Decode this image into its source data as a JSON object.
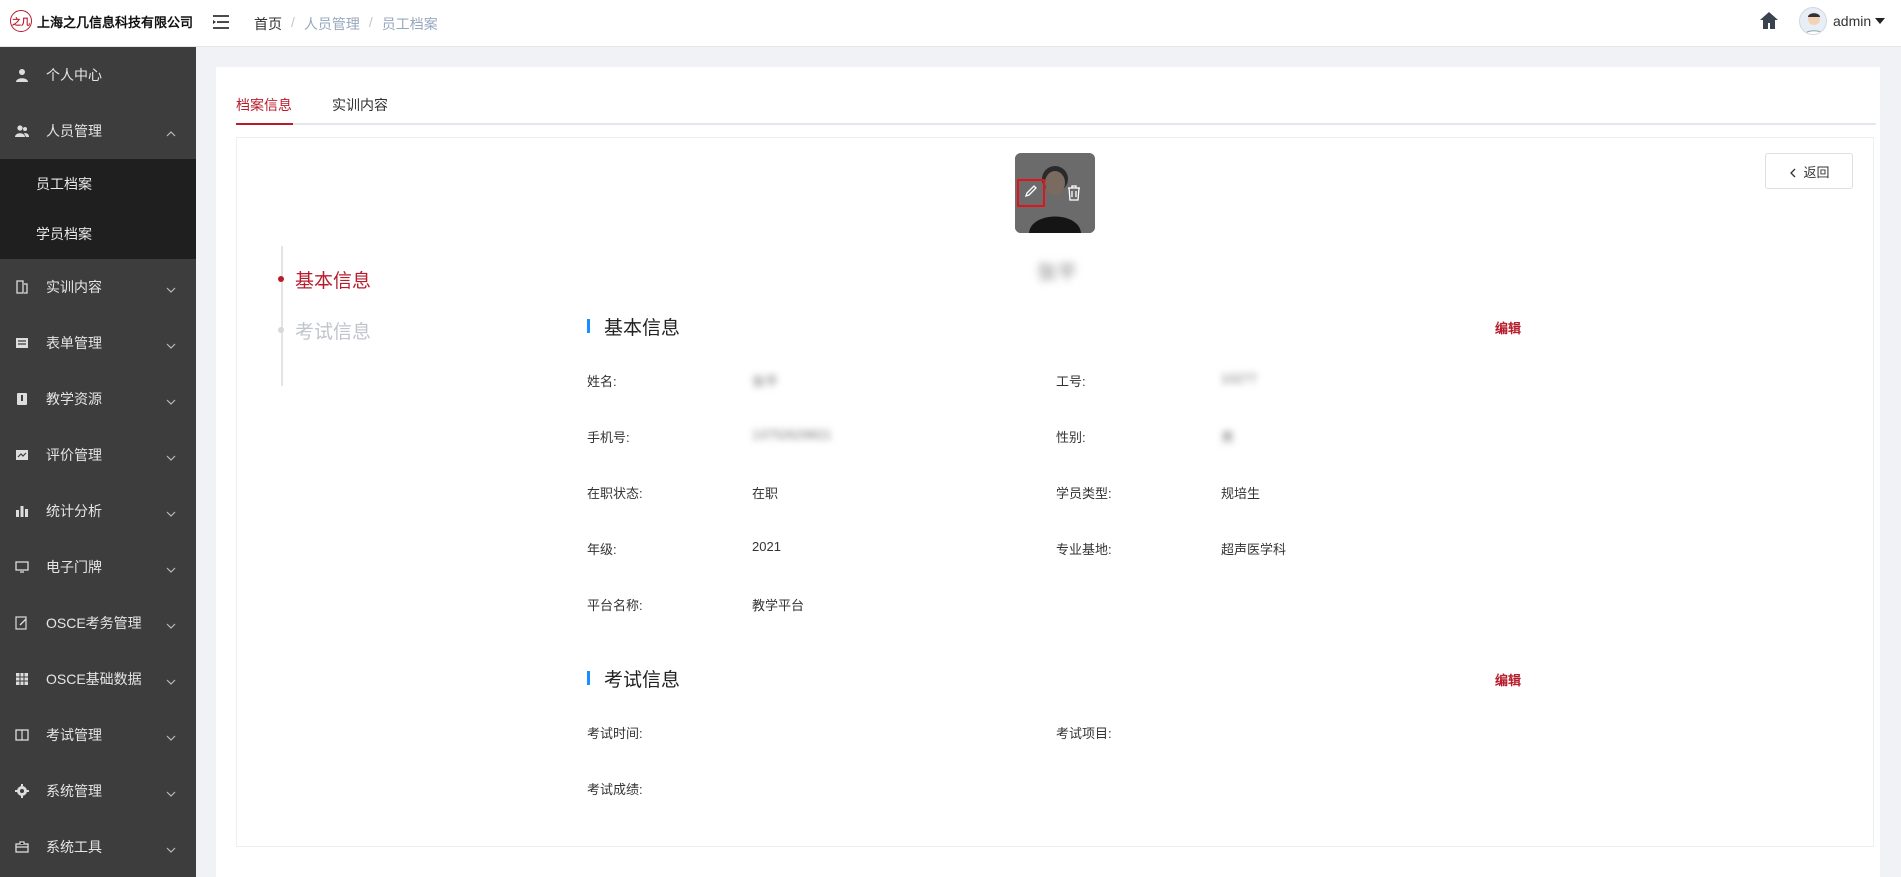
{
  "header": {
    "company_name": "上海之几信息科技有限公司",
    "logo_mark": "之几",
    "breadcrumb": [
      "首页",
      "人员管理",
      "员工档案"
    ],
    "breadcrumb_sep": "/",
    "username": "admin"
  },
  "sidebar": {
    "items": [
      {
        "label": "个人中心",
        "icon": "user-icon"
      },
      {
        "label": "人员管理",
        "icon": "users-icon",
        "expanded": true,
        "children": [
          {
            "label": "员工档案",
            "active": true
          },
          {
            "label": "学员档案"
          }
        ]
      },
      {
        "label": "实训内容",
        "icon": "book-icon"
      },
      {
        "label": "表单管理",
        "icon": "form-icon"
      },
      {
        "label": "教学资源",
        "icon": "resource-icon"
      },
      {
        "label": "评价管理",
        "icon": "evaluation-icon"
      },
      {
        "label": "统计分析",
        "icon": "bar-chart-icon"
      },
      {
        "label": "电子门牌",
        "icon": "monitor-icon"
      },
      {
        "label": "OSCE考务管理",
        "icon": "edit-doc-icon"
      },
      {
        "label": "OSCE基础数据",
        "icon": "grid-icon"
      },
      {
        "label": "考试管理",
        "icon": "exam-icon"
      },
      {
        "label": "系统管理",
        "icon": "gear-icon"
      },
      {
        "label": "系统工具",
        "icon": "toolbox-icon"
      }
    ]
  },
  "tabs": [
    {
      "label": "档案信息",
      "active": true
    },
    {
      "label": "实训内容",
      "active": false
    }
  ],
  "back_button": "返回",
  "profile": {
    "name": "张平"
  },
  "timeline": [
    {
      "label": "基本信息",
      "active": true
    },
    {
      "label": "考试信息",
      "active": false
    }
  ],
  "basic_info": {
    "title": "基本信息",
    "edit_label": "编辑",
    "fields": [
      {
        "label": "姓名:",
        "value": "张平",
        "blurred": true
      },
      {
        "label": "工号:",
        "value": "10277",
        "blurred": true
      },
      {
        "label": "手机号:",
        "value": "13752629821",
        "blurred": true
      },
      {
        "label": "性别:",
        "value": "男",
        "blurred": true
      },
      {
        "label": "在职状态:",
        "value": "在职"
      },
      {
        "label": "学员类型:",
        "value": "规培生"
      },
      {
        "label": "年级:",
        "value": "2021"
      },
      {
        "label": "专业基地:",
        "value": "超声医学科"
      },
      {
        "label": "平台名称:",
        "value": "教学平台"
      }
    ]
  },
  "exam_info": {
    "title": "考试信息",
    "edit_label": "编辑",
    "fields": [
      {
        "label": "考试时间:",
        "value": ""
      },
      {
        "label": "考试项目:",
        "value": ""
      },
      {
        "label": "考试成绩:",
        "value": ""
      }
    ]
  },
  "colors": {
    "accent": "#b71c2c",
    "sidebar_bg": "#3d3d3d",
    "submenu_bg": "#1f1f1f",
    "section_bar": "#1890ff"
  }
}
